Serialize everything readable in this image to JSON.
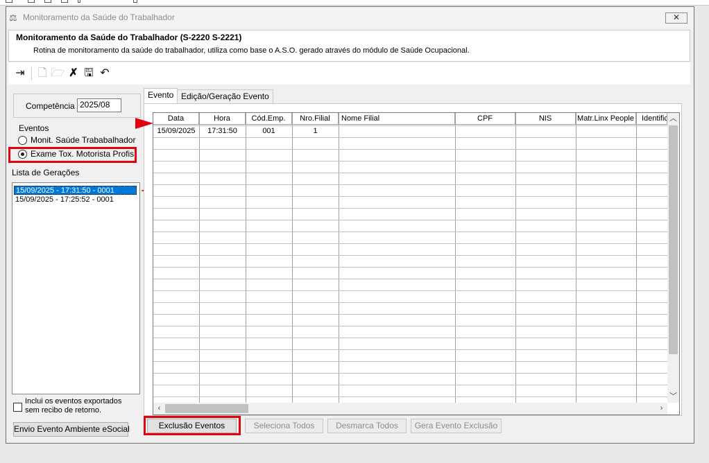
{
  "window": {
    "title": "Monitoramento da Saúde do Trabalhador",
    "close_icon": "close-icon"
  },
  "header": {
    "title": "Monitoramento da Saúde do Trabalhador (S-2220 S-2221)",
    "description": "Rotina de monitoramento da saúde do trabalhador, utiliza como base o A.S.O. gerado através do módulo de Saúde Ocupacional."
  },
  "toolbar": {
    "icons": [
      "exit-icon",
      "new-document-icon",
      "open-folder-icon",
      "delete-icon",
      "save-icon",
      "undo-icon"
    ]
  },
  "left_panel": {
    "competencia_label": "Competência",
    "competencia_value": "2025/08",
    "eventos_label": "Eventos",
    "radio_options": [
      {
        "label": "Monit. Saúde Trababalhador",
        "checked": false
      },
      {
        "label": "Exame Tox. Motorista Profis.",
        "checked": true
      }
    ],
    "lista_label": "Lista de Gerações",
    "geracoes": [
      {
        "text": "15/09/2025 - 17:31:50 - 0001",
        "selected": true
      },
      {
        "text": "15/09/2025 - 17:25:52 - 0001",
        "selected": false
      }
    ],
    "checkbox_label_line1": "Inclui os eventos exportados",
    "checkbox_label_line2": "sem recibo de retorno.",
    "envio_button": "Envio Evento Ambiente eSocial"
  },
  "tabs": [
    {
      "label": "Evento",
      "active": true
    },
    {
      "label": "Edição/Geração Evento",
      "active": false
    }
  ],
  "grid": {
    "columns": [
      "Data",
      "Hora",
      "Cód.Emp.",
      "Nro.Filial",
      "Nome Filial",
      "CPF",
      "NIS",
      "Matr.Linx People",
      "Identific"
    ],
    "rows": [
      [
        "15/09/2025",
        "17:31:50",
        "001",
        "1",
        "",
        "",
        "",
        "",
        ""
      ]
    ]
  },
  "buttons": {
    "exclusao": "Exclusão Eventos",
    "seleciona_todos": "Seleciona Todos",
    "desmarca_todos": "Desmarca Todos",
    "gera_evento_exclusao": "Gera Evento Exclusão"
  },
  "colors": {
    "highlight_red": "#e3000f",
    "selection_blue": "#0078d7"
  }
}
